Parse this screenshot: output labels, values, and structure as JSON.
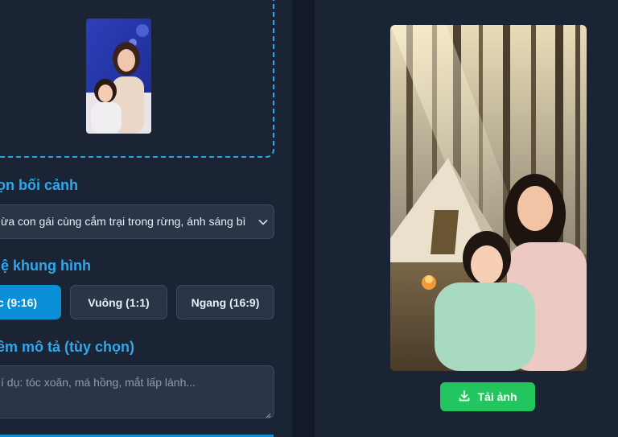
{
  "form": {
    "background_heading": "ọn bối cảnh",
    "background_selected": "ừa con gái cùng cắm trại trong rừng, ánh sáng bì",
    "ratio_heading": "lệ khung hình",
    "ratios": [
      {
        "label": "c (9:16)",
        "active": true
      },
      {
        "label": "Vuông (1:1)",
        "active": false
      },
      {
        "label": "Ngang (16:9)",
        "active": false
      }
    ],
    "description_heading": "êm mô tả (tùy chọn)",
    "description_placeholder": "í dụ: tóc xoăn, má hồng, mắt lấp lánh..."
  },
  "result": {
    "download_label": "Tải ảnh"
  },
  "icons": {
    "chevron": "chevron-down-icon",
    "download": "download-icon",
    "resize": "resize-handle-icon"
  },
  "colors": {
    "accent": "#2ea8ee",
    "active_button": "#0b8fd6",
    "download_button": "#22c55e",
    "panel_bg": "#1b2434",
    "input_bg": "#2a3648"
  }
}
